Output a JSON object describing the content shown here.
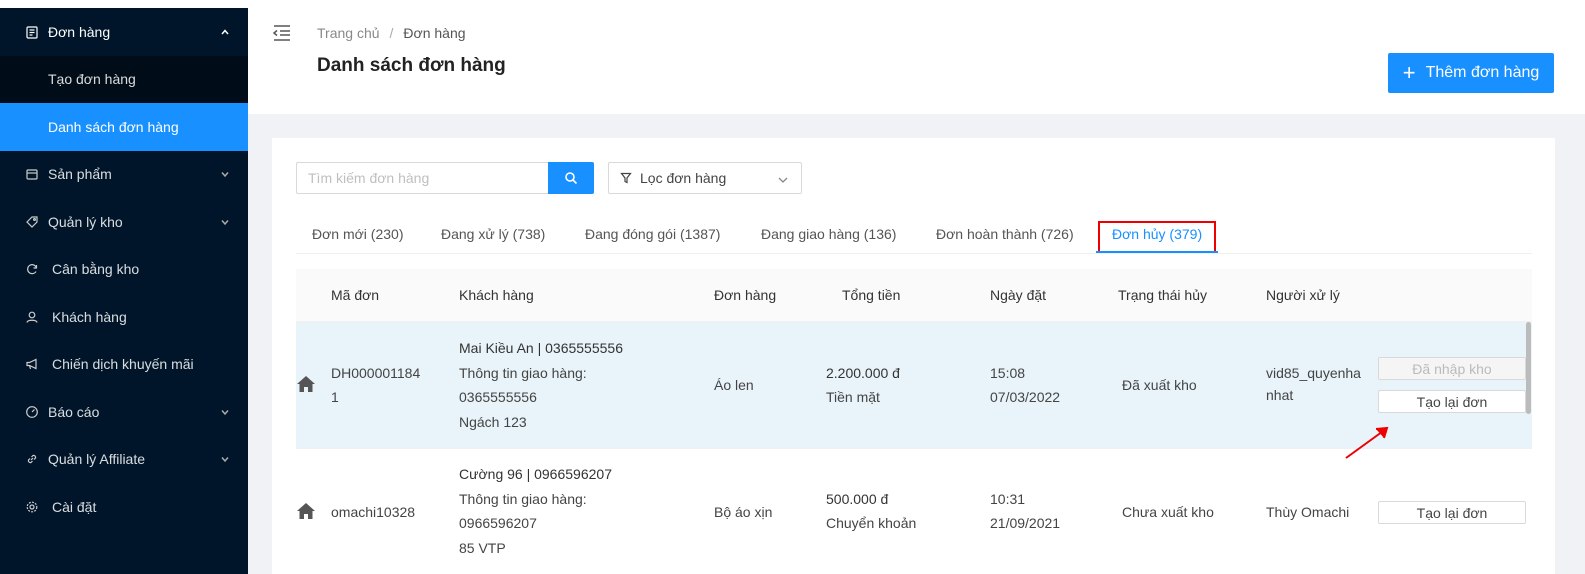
{
  "sidebar": {
    "items": [
      {
        "label": "Đơn hàng",
        "icon": "order-icon",
        "open": true,
        "children": [
          {
            "label": "Tạo đơn hàng",
            "active": false
          },
          {
            "label": "Danh sách đơn hàng",
            "active": true
          }
        ]
      },
      {
        "label": "Sản phẩm",
        "icon": "product-icon",
        "has_arrow": true
      },
      {
        "label": "Quản lý kho",
        "icon": "tag-icon",
        "has_arrow": true
      },
      {
        "label": "Cân bằng kho",
        "icon": "sync-icon",
        "has_arrow": false
      },
      {
        "label": "Khách hàng",
        "icon": "user-icon",
        "has_arrow": false
      },
      {
        "label": "Chiến dịch khuyến mãi",
        "icon": "megaphone-icon",
        "has_arrow": false
      },
      {
        "label": "Báo cáo",
        "icon": "dashboard-icon",
        "has_arrow": true
      },
      {
        "label": "Quản lý Affiliate",
        "icon": "link-icon",
        "has_arrow": true
      },
      {
        "label": "Cài đặt",
        "icon": "gear-icon",
        "has_arrow": false
      }
    ],
    "bg_color": "#001529",
    "active_color": "#1890ff"
  },
  "header": {
    "breadcrumb": [
      "Trang chủ",
      "Đơn hàng"
    ],
    "breadcrumb_sep": "/",
    "title": "Danh sách đơn hàng",
    "add_button_label": "Thêm đơn hàng"
  },
  "search": {
    "placeholder": "Tìm kiếm đơn hàng",
    "value": ""
  },
  "filter": {
    "label": "Lọc đơn hàng"
  },
  "tabs": [
    {
      "label": "Đơn mới (230)",
      "active": false
    },
    {
      "label": "Đang xử lý (738)",
      "active": false
    },
    {
      "label": "Đang đóng gói (1387)",
      "active": false
    },
    {
      "label": "Đang giao hàng (136)",
      "active": false
    },
    {
      "label": "Đơn hoàn thành (726)",
      "active": false
    },
    {
      "label": "Đơn hủy (379)",
      "active": true
    }
  ],
  "table": {
    "columns": [
      "Mã đơn",
      "Khách hàng",
      "Đơn hàng",
      "Tổng tiền",
      "Ngày đặt",
      "Trạng thái hủy",
      "Người xử lý"
    ],
    "rows": [
      {
        "code_line1": "DH000001184",
        "code_line2": "1",
        "customer": "Mai Kiều An | 0365555556",
        "shipping_label": "Thông tin giao hàng:",
        "shipping_phone": "0365555556",
        "shipping_address": "Ngách 123",
        "product": "Áo len",
        "total": "2.200.000 đ",
        "payment": "Tiền mặt",
        "time": "15:08",
        "date": "07/03/2022",
        "cancel_status": "Đã xuất kho",
        "handler_line1": "vid85_quyenha",
        "handler_line2": "nhat",
        "btn_imported": "Đã nhập kho",
        "btn_recreate": "Tạo lại đơn"
      },
      {
        "code_line1": "omachi10328",
        "customer": "Cường 96 | 0966596207",
        "shipping_label": "Thông tin giao hàng:",
        "shipping_phone": "0966596207",
        "shipping_address": "85 VTP",
        "product": "Bộ áo xịn",
        "total": "500.000 đ",
        "payment": "Chuyển khoản",
        "time": "10:31",
        "date": "21/09/2021",
        "cancel_status": "Chưa xuất kho",
        "handler_line1": "Thùy Omachi",
        "btn_recreate": "Tạo lại đơn"
      }
    ]
  },
  "colors": {
    "primary": "#1890ff",
    "highlight_row": "#e8f4fa",
    "annotation": "#e00000"
  }
}
